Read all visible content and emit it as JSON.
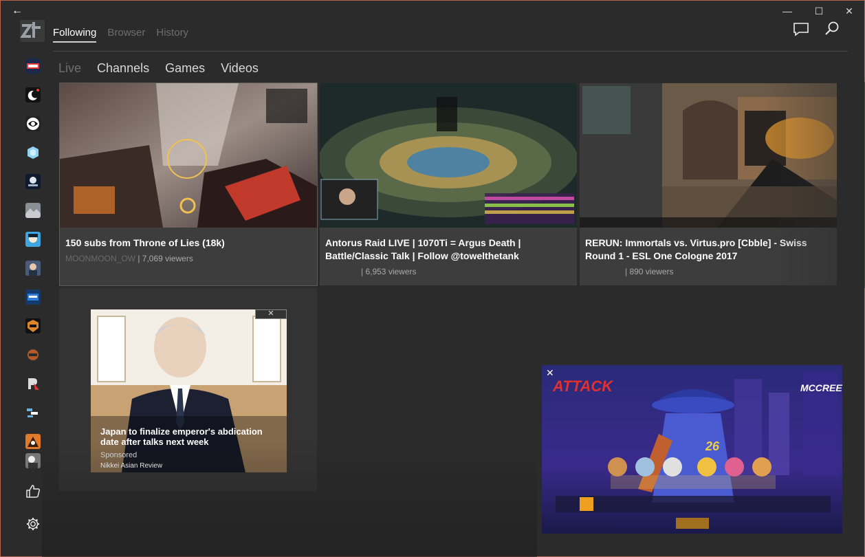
{
  "window": {
    "back_glyph": "←",
    "minimize_glyph": "—",
    "maximize_glyph": "☐",
    "close_glyph": "✕"
  },
  "header": {
    "nav": [
      {
        "label": "Following",
        "active": true
      },
      {
        "label": "Browser",
        "active": false
      },
      {
        "label": "History",
        "active": false
      }
    ],
    "icons": [
      "chat-icon",
      "search-icon"
    ]
  },
  "sidebar": {
    "channels": [
      {
        "name": "channel-avatar-1"
      },
      {
        "name": "channel-avatar-2"
      },
      {
        "name": "channel-avatar-3"
      },
      {
        "name": "channel-avatar-4"
      },
      {
        "name": "channel-avatar-5"
      },
      {
        "name": "channel-avatar-6"
      },
      {
        "name": "channel-avatar-7"
      },
      {
        "name": "channel-avatar-8"
      },
      {
        "name": "channel-avatar-9"
      },
      {
        "name": "channel-avatar-10"
      },
      {
        "name": "channel-avatar-11"
      },
      {
        "name": "channel-avatar-12"
      },
      {
        "name": "channel-avatar-13"
      },
      {
        "name": "channel-avatar-14"
      },
      {
        "name": "channel-avatar-15"
      }
    ],
    "bottom_icons": [
      "thumbs-up-icon",
      "gear-icon"
    ]
  },
  "tabs": [
    {
      "label": "Live",
      "active": true
    },
    {
      "label": "Channels",
      "active": false
    },
    {
      "label": "Games",
      "active": false
    },
    {
      "label": "Videos",
      "active": false
    }
  ],
  "streams": [
    {
      "title": "150 subs from Throne of Lies  (18k)",
      "channel": "MOONMOON_OW",
      "viewers": "| 7,069 viewers"
    },
    {
      "title": "Antorus Raid LIVE | 1070Ti = Argus Death | Battle/Classic Talk | Follow @towelthetank",
      "channel": "",
      "viewers": "| 6,953 viewers"
    },
    {
      "title": "RERUN: Immortals vs. Virtus.pro [Cbble] - Swiss Round 1 - ESL One Cologne 2017",
      "channel": "",
      "viewers": "| 890 viewers"
    }
  ],
  "ad": {
    "close_glyph": "✕",
    "headline": "Japan to finalize emperor's abdication date after talks next week",
    "sponsored": "Sponsored",
    "source": "Nikkei Asian Review"
  },
  "pip": {
    "close_glyph": "✕"
  },
  "colors": {
    "background": "#2b2b2b",
    "card": "#3d3d3d",
    "window_border": "#b5654a"
  }
}
